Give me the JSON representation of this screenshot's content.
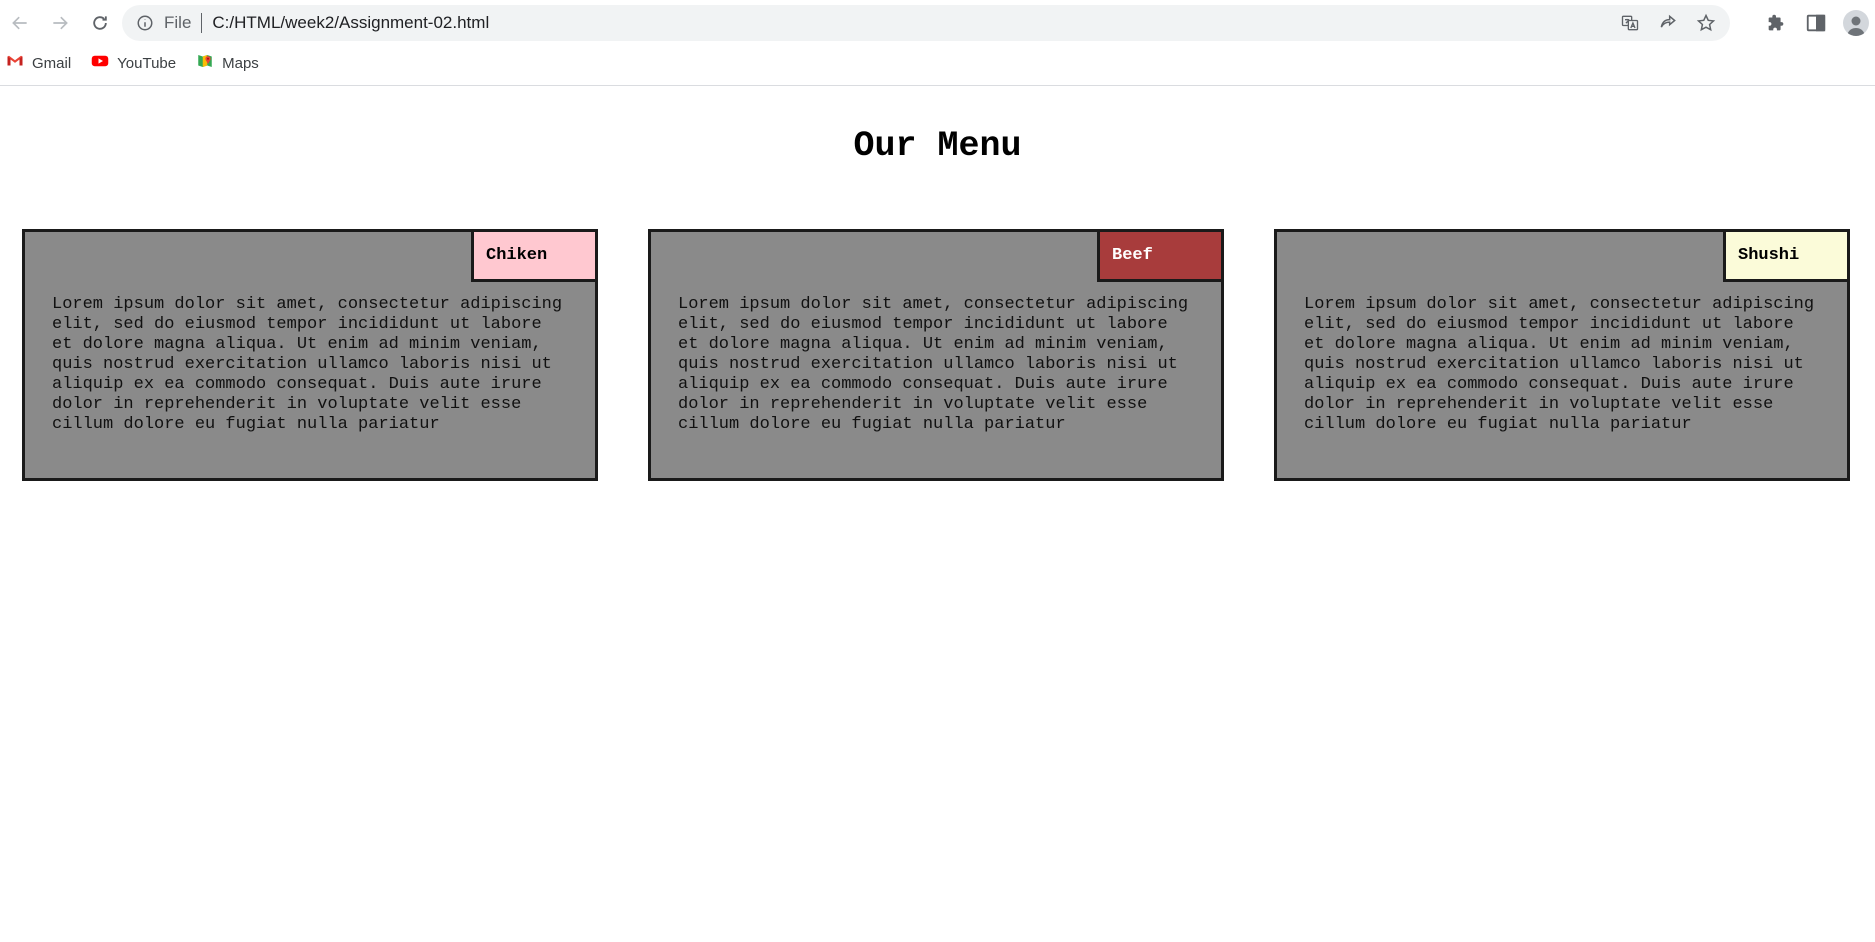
{
  "browser": {
    "scheme_label": "File",
    "url": "C:/HTML/week2/Assignment-02.html",
    "icons": {
      "back": "arrow-left-icon",
      "forward": "arrow-right-icon",
      "reload": "reload-icon",
      "info": "info-icon",
      "translate": "translate-icon",
      "share": "share-icon",
      "bookmark": "star-icon",
      "extensions": "puzzle-icon",
      "side_panel": "side-panel-icon",
      "profile": "profile-avatar-icon"
    },
    "bookmarks": [
      {
        "label": "Gmail",
        "icon": "gmail-icon"
      },
      {
        "label": "YouTube",
        "icon": "youtube-icon"
      },
      {
        "label": "Maps",
        "icon": "maps-icon"
      }
    ]
  },
  "page": {
    "title": "Our Menu",
    "cards": [
      {
        "tag": "Chiken",
        "tag_bg": "#ffc8d0",
        "tag_color": "#000000",
        "text": "Lorem ipsum dolor sit amet, consectetur adipiscing elit, sed do eiusmod tempor incididunt ut labore et dolore magna aliqua. Ut enim ad minim veniam, quis nostrud exercitation ullamco laboris nisi ut aliquip ex ea commodo consequat. Duis aute irure dolor in reprehenderit in voluptate velit esse cillum dolore eu fugiat nulla pariatur"
      },
      {
        "tag": "Beef",
        "tag_bg": "#a83c3c",
        "tag_color": "#ffffff",
        "text": "Lorem ipsum dolor sit amet, consectetur adipiscing elit, sed do eiusmod tempor incididunt ut labore et dolore magna aliqua. Ut enim ad minim veniam, quis nostrud exercitation ullamco laboris nisi ut aliquip ex ea commodo consequat. Duis aute irure dolor in reprehenderit in voluptate velit esse cillum dolore eu fugiat nulla pariatur"
      },
      {
        "tag": "Shushi",
        "tag_bg": "#fbfbd9",
        "tag_color": "#000000",
        "text": "Lorem ipsum dolor sit amet, consectetur adipiscing elit, sed do eiusmod tempor incididunt ut labore et dolore magna aliqua. Ut enim ad minim veniam, quis nostrud exercitation ullamco laboris nisi ut aliquip ex ea commodo consequat. Duis aute irure dolor in reprehenderit in voluptate velit esse cillum dolore eu fugiat nulla pariatur"
      }
    ],
    "colors": {
      "card_bg": "#8a8a8a",
      "card_border": "#1a1a1a"
    }
  }
}
